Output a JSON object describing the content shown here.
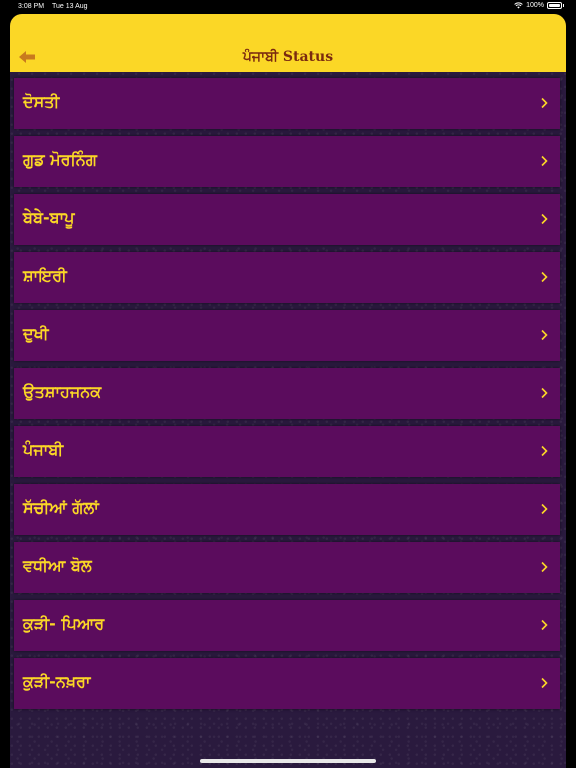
{
  "status_bar": {
    "time": "3:08 PM",
    "date": "Tue 13 Aug",
    "battery": "100%"
  },
  "nav": {
    "title": "ਪੰਜਾਬੀ Status",
    "back_icon": "back-arrow-icon"
  },
  "colors": {
    "nav_bg": "#fbd726",
    "item_bg": "#5b0c5d",
    "item_text": "#fbd726",
    "title_text": "#7a2a10"
  },
  "list": {
    "items": [
      {
        "label": "ਦੋਸਤੀ"
      },
      {
        "label": "ਗੁਡ ਮੋਰਨਿੰਗ"
      },
      {
        "label": "ਬੇਬੇ-ਬਾਪੂ"
      },
      {
        "label": "ਸ਼ਾਇਰੀ"
      },
      {
        "label": "ਦੁਖੀ"
      },
      {
        "label": "ਉਤਸ਼ਾਹਜਨਕ"
      },
      {
        "label": "ਪੰਜਾਬੀ"
      },
      {
        "label": "ਸੱਚੀਆਂ ਗੱਲਾਂ"
      },
      {
        "label": "ਵਧੀਆ ਬੋਲ"
      },
      {
        "label": "ਕੁੜੀ- ਪਿਆਰ"
      },
      {
        "label": "ਕੁੜੀ-ਨਖ਼ਰਾ"
      }
    ]
  }
}
